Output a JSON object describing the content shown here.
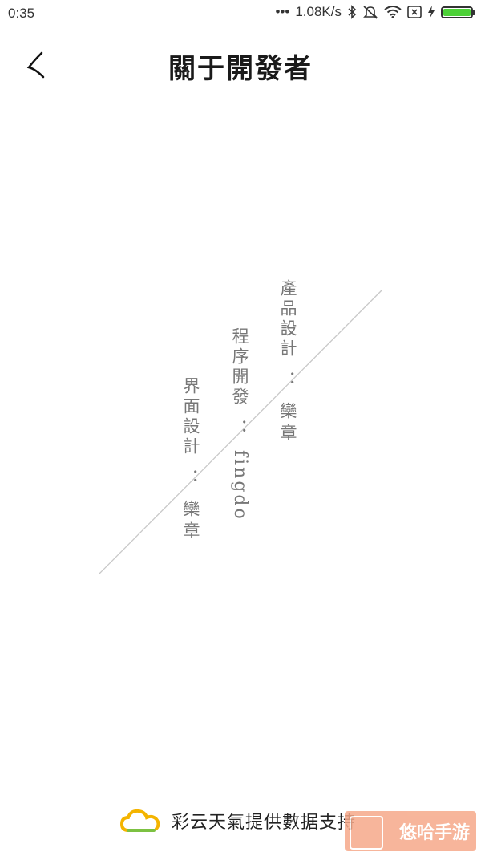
{
  "status_bar": {
    "time": "0:35",
    "net_speed": "1.08K/s"
  },
  "header": {
    "title": "關于開發者"
  },
  "credits": [
    {
      "role": "產品設計",
      "sep": "：",
      "name": "欒章"
    },
    {
      "role": "程序開發",
      "sep": "：",
      "name": "fingdo"
    },
    {
      "role": "界面設計",
      "sep": "：",
      "name": "欒章"
    }
  ],
  "footer": {
    "text": "彩云天氣提供數据支持"
  },
  "watermark": {
    "text": "悠哈手游"
  },
  "colors": {
    "battery": "#4cd137",
    "logo_yellow": "#f4b400",
    "logo_green": "#7cc142"
  }
}
